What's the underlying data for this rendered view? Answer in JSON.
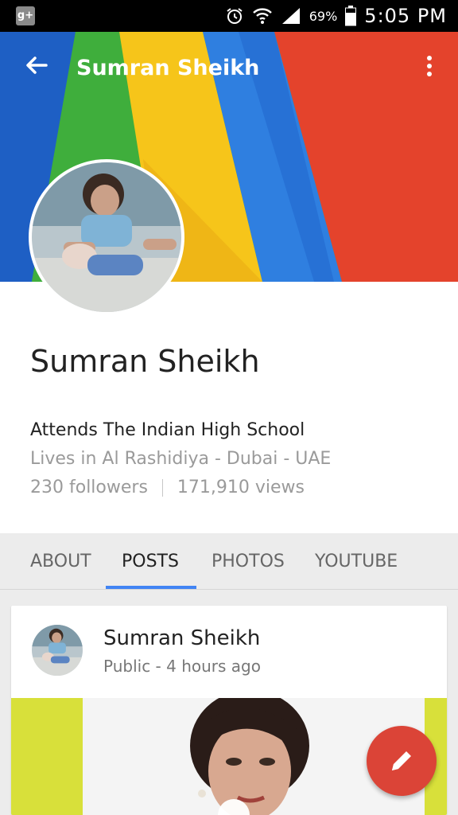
{
  "status_bar": {
    "notification_icon": "google-plus-icon",
    "notification_text": "g+",
    "battery_percent": "69%",
    "time": "5:05 PM"
  },
  "appbar": {
    "title": "Sumran Sheikh",
    "back_icon": "arrow-back-icon",
    "menu_icon": "more-vert-icon"
  },
  "profile": {
    "name": "Sumran Sheikh",
    "attends": "Attends The Indian High School",
    "lives": "Lives in Al Rashidiya - Dubai - UAE",
    "followers": "230 followers",
    "views": "171,910 views"
  },
  "tabs": [
    "ABOUT",
    "POSTS",
    "PHOTOS",
    "YOUTUBE"
  ],
  "active_tab": "POSTS",
  "post": {
    "author": "Sumran Sheikh",
    "meta": "Public - 4 hours ago"
  },
  "fab_icon": "pencil-icon",
  "colors": {
    "accent_blue": "#4285f4",
    "fab_red": "#db4437",
    "cover_blue": "#1e5fc4",
    "cover_green": "#3fae3c",
    "cover_yellow": "#f6c51a",
    "cover_red": "#e4432c"
  }
}
